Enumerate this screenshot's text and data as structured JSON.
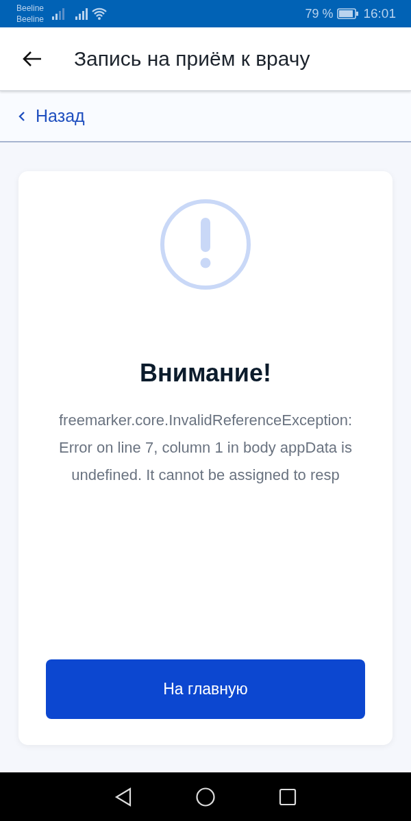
{
  "status_bar": {
    "carriers": [
      "Beeline",
      "Beeline"
    ],
    "battery": "79 %",
    "time": "16:01"
  },
  "app_bar": {
    "title": "Запись на приём к врачу"
  },
  "back_link": {
    "label": "Назад"
  },
  "card": {
    "heading": "Внимание!",
    "message": "freemarker.core.InvalidReferenceException: Error on line 7, column 1 in body appData is undefined. It cannot be assigned to resp",
    "button": "На главную"
  }
}
